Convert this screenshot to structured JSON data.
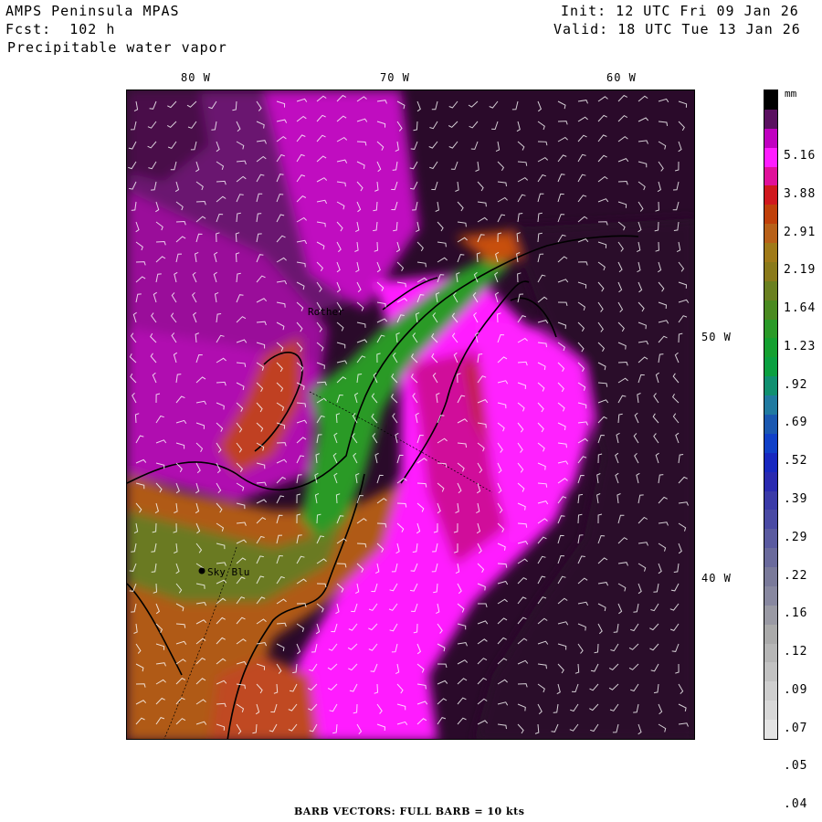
{
  "header": {
    "model": "AMPS Peninsula MPAS",
    "forecast": "Fcst:  102 h",
    "field": "Precipitable water vapor",
    "init": "Init: 12 UTC Fri 09 Jan 26",
    "valid": "Valid: 18 UTC Tue 13 Jan 26"
  },
  "axes": {
    "lon_labels": [
      "80 W",
      "70 W",
      "60 W"
    ],
    "lat_labels": [
      "50 W",
      "40 W"
    ]
  },
  "map": {
    "stations": [
      {
        "name": "Rother"
      },
      {
        "name": "Sky Blu"
      }
    ]
  },
  "legend": {
    "unit": "mm",
    "labels": [
      "5.16",
      "3.88",
      "2.91",
      "2.19",
      "1.64",
      "1.23",
      ".92",
      ".69",
      ".52",
      ".39",
      ".29",
      ".22",
      ".16",
      ".12",
      ".09",
      ".07",
      ".05",
      ".04"
    ],
    "colors": [
      "#000000",
      "#5a1060",
      "#c000c0",
      "#ff1cff",
      "#e0109a",
      "#d0181e",
      "#c0400a",
      "#b86018",
      "#a07a18",
      "#8a7a1a",
      "#6a8020",
      "#4a8a20",
      "#2a9a28",
      "#14a030",
      "#0aa040",
      "#109070",
      "#207aa0",
      "#1a58b0",
      "#1040c8",
      "#1828c0",
      "#2a2ab0",
      "#3a3aa8",
      "#4a4aa4",
      "#5a5aa0",
      "#6a6a9c",
      "#7a7a9a",
      "#8888a0",
      "#9a9aa4",
      "#aaaaaa",
      "#b6b6b6",
      "#c2c2c2",
      "#cecece",
      "#d8d8d8",
      "#e4e4e4"
    ]
  },
  "footer": "BARB VECTORS:  FULL BARB = 10 kts"
}
